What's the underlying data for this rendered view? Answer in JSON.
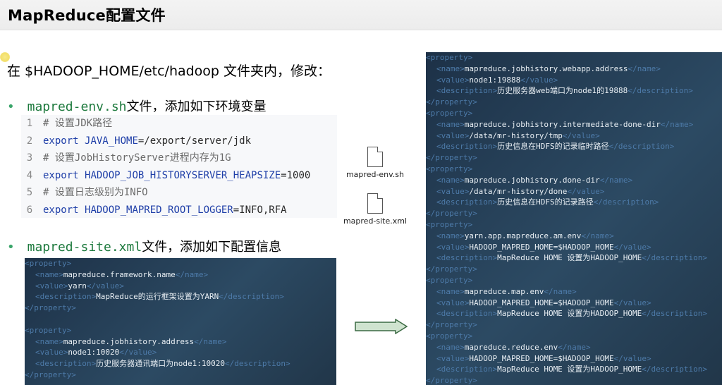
{
  "title": "MapReduce配置文件",
  "intro": "在 $HADOOP_HOME/etc/hadoop 文件夹内，修改：",
  "bullets": [
    {
      "file": "mapred-env.sh",
      "text": "文件，添加如下环境变量"
    },
    {
      "file": "mapred-site.xml",
      "text": "文件，添加如下配置信息"
    }
  ],
  "env_code": [
    {
      "n": "1",
      "kind": "comment",
      "text": "# 设置JDK路径"
    },
    {
      "n": "2",
      "kind": "export",
      "kw": "export",
      "var": "JAVA_HOME",
      "val": "=/export/server/jdk"
    },
    {
      "n": "3",
      "kind": "comment",
      "text": "# 设置JobHistoryServer进程内存为1G"
    },
    {
      "n": "4",
      "kind": "export",
      "kw": "export",
      "var": "HADOOP_JOB_HISTORYSERVER_HEAPSIZE",
      "val": "=1000"
    },
    {
      "n": "5",
      "kind": "comment",
      "text": "# 设置日志级别为INFO"
    },
    {
      "n": "6",
      "kind": "export",
      "kw": "export",
      "var": "HADOOP_MAPRED_ROOT_LOGGER",
      "val": "=INFO,RFA"
    }
  ],
  "files": [
    "mapred-env.sh",
    "mapred-site.xml"
  ],
  "xml_left": [
    {
      "name": "mapreduce.framework.name",
      "value": "yarn",
      "description": "MapReduce的运行框架设置为YARN"
    },
    {
      "name": "mapreduce.jobhistory.address",
      "value": "node1:10020",
      "description": "历史服务器通讯端口为node1:10020"
    }
  ],
  "xml_right": [
    {
      "name": "mapreduce.jobhistory.webapp.address",
      "value": "node1:19888",
      "description": "历史服务器web端口为node1的19888"
    },
    {
      "name": "mapreduce.jobhistory.intermediate-done-dir",
      "value": "/data/mr-history/tmp",
      "description": "历史信息在HDFS的记录临时路径"
    },
    {
      "name": "mapreduce.jobhistory.done-dir",
      "value": "/data/mr-history/done",
      "description": "历史信息在HDFS的记录路径"
    },
    {
      "name": "yarn.app.mapreduce.am.env",
      "value": "HADOOP_MAPRED_HOME=$HADOOP_HOME",
      "description": "MapReduce HOME 设置为HADOOP_HOME"
    },
    {
      "name": "mapreduce.map.env",
      "value": "HADOOP_MAPRED_HOME=$HADOOP_HOME",
      "description": "MapReduce HOME 设置为HADOOP_HOME"
    },
    {
      "name": "mapreduce.reduce.env",
      "value": "HADOOP_MAPRED_HOME=$HADOOP_HOME",
      "description": "MapReduce HOME 设置为HADOOP_HOME"
    }
  ],
  "tags": {
    "property": "property",
    "name": "name",
    "value": "value",
    "description": "description"
  }
}
